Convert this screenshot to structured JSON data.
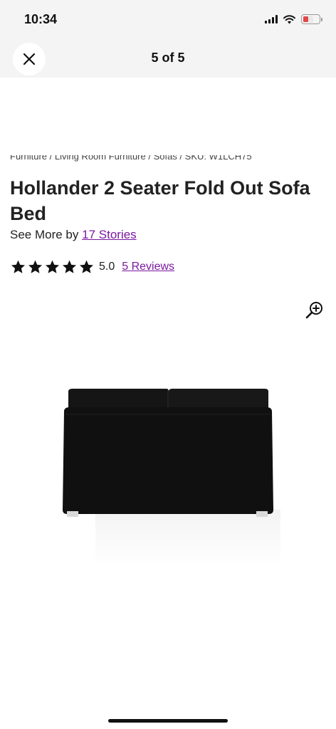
{
  "status_bar": {
    "time": "10:34",
    "battery_level": "1"
  },
  "nav": {
    "title": "5 of 5",
    "close_icon": "close-icon"
  },
  "breadcrumb": {
    "text": "Furniture / Living Room Furniture / Sofas / SKU: W1LCH75"
  },
  "product": {
    "title": "Hollander 2 Seater Fold Out Sofa Bed",
    "see_more_prefix": "See More by",
    "brand": "17 Stories",
    "rating_value": "5.0",
    "stars_filled": 5,
    "reviews_label": "5 Reviews"
  },
  "image": {
    "description_icon": "zoom-in-icon",
    "sofa_color": "#121212"
  },
  "colors": {
    "accent_link": "#7b189f",
    "header_bg": "#f4f4f4"
  }
}
